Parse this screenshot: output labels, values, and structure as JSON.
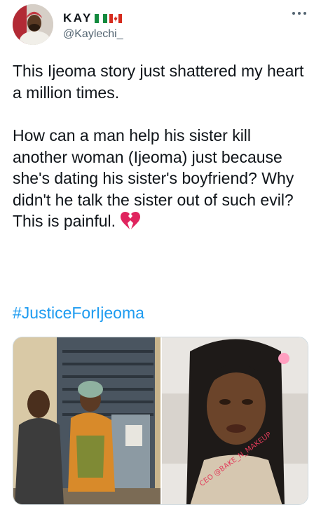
{
  "author": {
    "display_name": "KAY",
    "handle": "@Kaylechi_",
    "flags": [
      "nigeria-flag-icon",
      "canada-flag-icon"
    ]
  },
  "more_icon": "more-options-icon",
  "tweet": {
    "paragraph_1": "This Ijeoma story just shattered my heart a million times.",
    "paragraph_2": "How can a man help his sister kill another woman (Ijeoma) just because she's dating his sister's boyfriend? Why didn't he talk the sister out of such evil? This is painful.",
    "emoji": "broken-heart-icon",
    "hashtag": "#JusticeForIjeoma"
  },
  "media": {
    "photo_left": "photo of a man and a woman in custody",
    "photo_right": "selfie photo of a woman",
    "watermark": "CEO @BAKE_N_MAKEUP"
  },
  "colors": {
    "link": "#1d9bf0",
    "text": "#0f1419",
    "secondary": "#536471"
  }
}
